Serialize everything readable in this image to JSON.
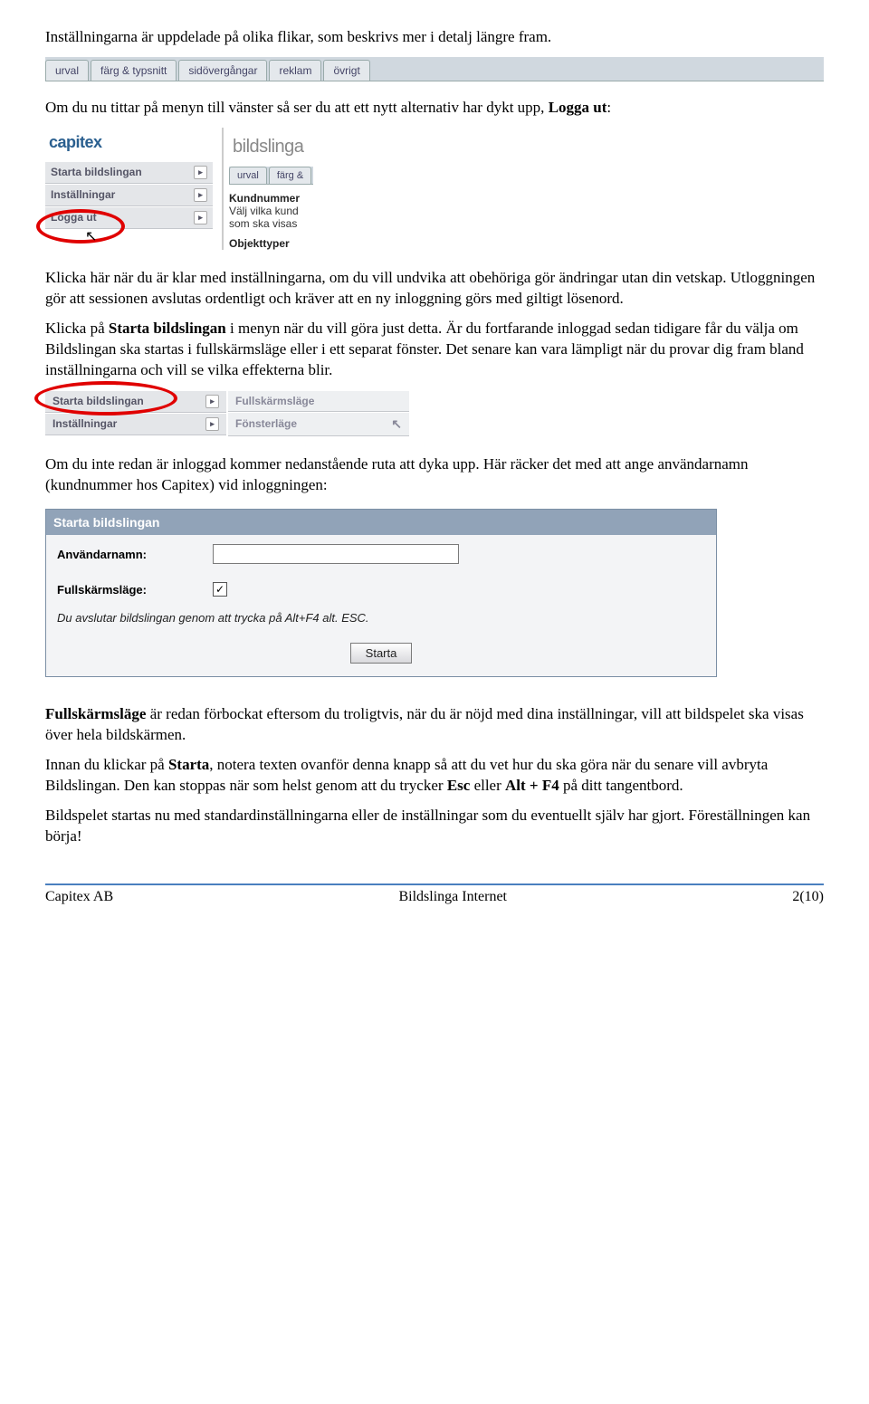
{
  "intro_text": "Inställningarna är uppdelade på olika flikar, som beskrivs mer i detalj längre fram.",
  "tabs": [
    "urval",
    "färg & typsnitt",
    "sidövergångar",
    "reklam",
    "övrigt"
  ],
  "para2_a": "Om du nu tittar på menyn till vänster så ser du att ett nytt alternativ har dykt upp, ",
  "para2_b": "Logga ut",
  "para2_c": ":",
  "brand_left": "capitex",
  "brand_right": "bildslinga",
  "sidebar_items": [
    "Starta bildslingan",
    "Inställningar",
    "Logga ut"
  ],
  "mini_tabs": [
    "urval",
    "färg &"
  ],
  "kv1_label": "Kundnummer",
  "kv1_sub1": "Välj vilka kund",
  "kv1_sub2": "som ska visas",
  "kv2_label": "Objekttyper",
  "para3_a": "Klicka här när du är klar med inställningarna, om du vill undvika att obehöriga gör ändringar utan din vetskap. Utloggningen gör att sessionen avslutas ordentligt och kräver att en ny inloggning görs med giltigt lösenord.",
  "para4_a": "Klicka på ",
  "para4_b": "Starta bildslingan",
  "para4_c": " i menyn när du vill göra just detta. Är du fortfarande inloggad sedan tidigare får du välja om Bildslingan ska startas i fullskärmsläge eller i ett separat fönster. Det senare kan vara lämpligt när du provar dig fram bland inställningarna och vill se vilka effekterna blir.",
  "menu2_left": [
    "Starta bildslingan",
    "Inställningar"
  ],
  "menu2_right": [
    "Fullskärmsläge",
    "Fönsterläge"
  ],
  "para5": "Om du inte redan är inloggad kommer nedanstående ruta att dyka upp. Här räcker det med att ange användarnamn (kundnummer hos Capitex) vid inloggningen:",
  "start_head": "Starta bildslingan",
  "start_user_label": "Användarnamn:",
  "start_full_label": "Fullskärmsläge:",
  "start_check_mark": "✓",
  "start_note": "Du avslutar bildslingan genom att trycka på Alt+F4 alt. ESC.",
  "start_btn": "Starta",
  "para6_a": "Fullskärmsläge",
  "para6_b": " är redan förbockat eftersom du troligtvis, när du är nöjd med dina inställningar, vill att bildspelet ska visas över hela bildskärmen.",
  "para7_a": "Innan du klickar på ",
  "para7_b": "Starta",
  "para7_c": ", notera texten ovanför denna knapp så att du vet hur du ska göra när du senare vill avbryta Bildslingan. Den kan stoppas när som helst genom att du trycker ",
  "para7_d": "Esc",
  "para7_e": " eller ",
  "para7_f": "Alt + F4",
  "para7_g": " på ditt tangentbord.",
  "para8": "Bildspelet startas nu med standardinställningarna eller de inställningar som du eventuellt själv har gjort. Föreställningen kan börja!",
  "footer_left": "Capitex AB",
  "footer_center": "Bildslinga Internet",
  "footer_right": "2(10)"
}
